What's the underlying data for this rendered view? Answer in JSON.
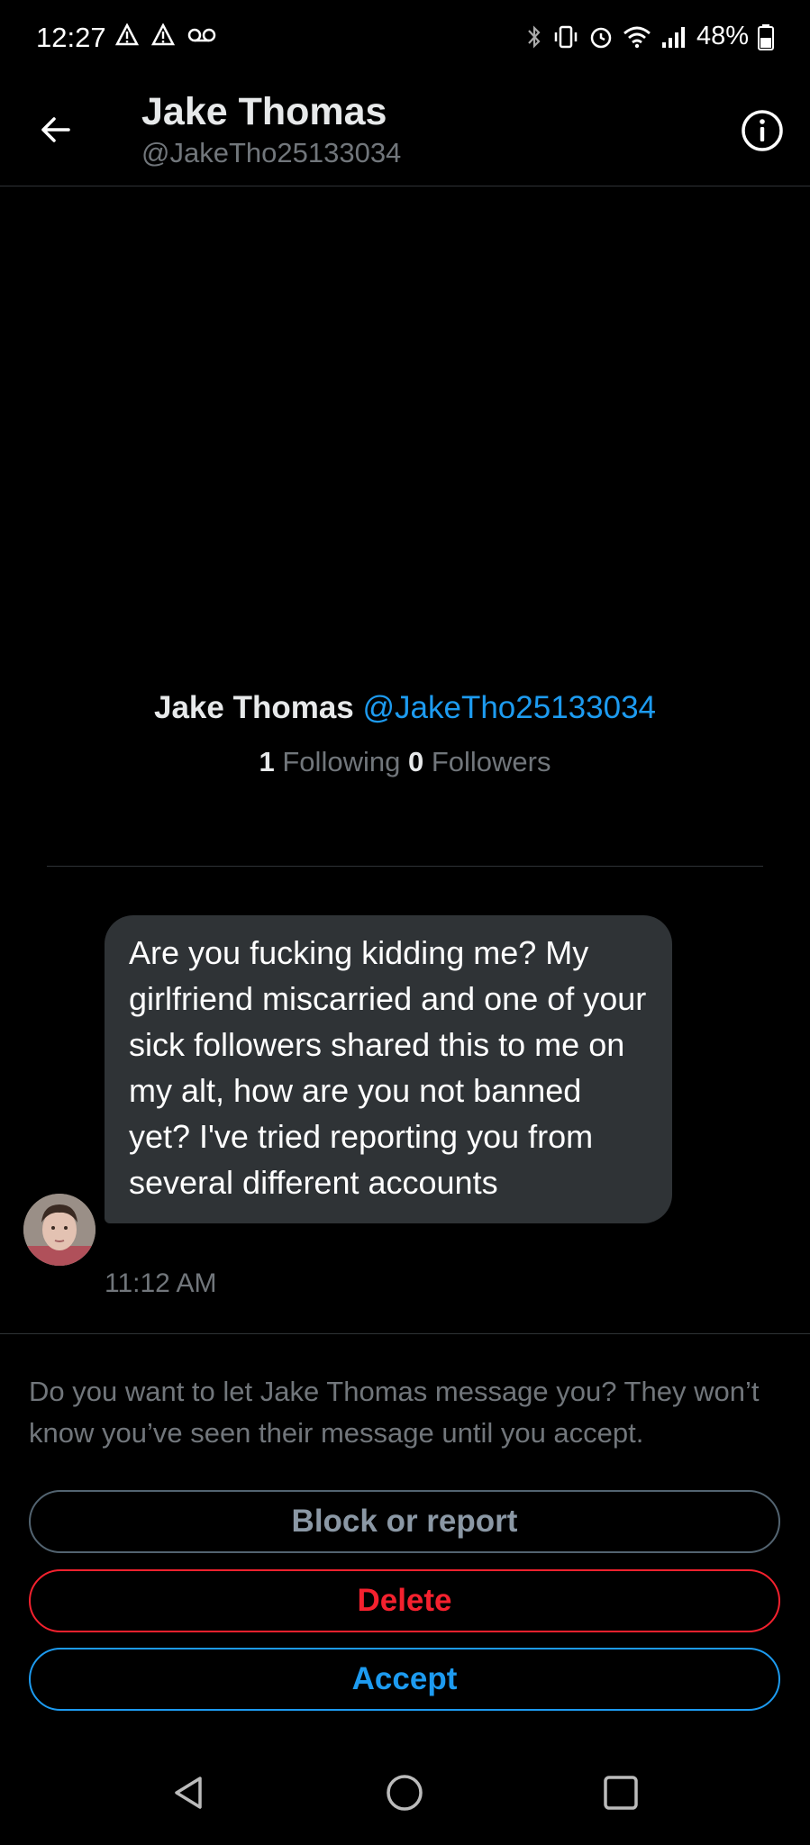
{
  "status_bar": {
    "time": "12:27",
    "battery_percent": "48%",
    "left_icons": [
      "alert-icon",
      "alert-icon",
      "voicemail-icon"
    ],
    "right_icons": [
      "bluetooth-icon",
      "vibrate-icon",
      "alarm-icon",
      "wifi-icon",
      "signal-icon",
      "battery-icon"
    ]
  },
  "header": {
    "name": "Jake Thomas",
    "handle": "@JakeTho25133034",
    "back_icon": "arrow-left-icon",
    "info_icon": "info-icon"
  },
  "profile": {
    "name": "Jake Thomas",
    "handle": "@JakeTho25133034",
    "following_count": "1",
    "following_label": "Following",
    "followers_count": "0",
    "followers_label": "Followers"
  },
  "message": {
    "text": "Are you fucking kidding me? My girlfriend miscarried and one of your sick followers shared this to me on my alt, how are you not banned yet? I've tried reporting you from several different accounts",
    "time": "11:12 AM"
  },
  "request": {
    "prompt": "Do you want to let Jake Thomas message you? They won’t know you’ve seen their message until you accept.",
    "block_label": "Block or report",
    "delete_label": "Delete",
    "accept_label": "Accept"
  },
  "nav_bar": {
    "icons": [
      "nav-back-icon",
      "nav-home-icon",
      "nav-recents-icon"
    ]
  },
  "colors": {
    "background": "#000000",
    "bubble": "#2f3336",
    "accent_blue": "#1d9bf0",
    "danger_red": "#f4212e",
    "muted_text": "#71767b"
  }
}
